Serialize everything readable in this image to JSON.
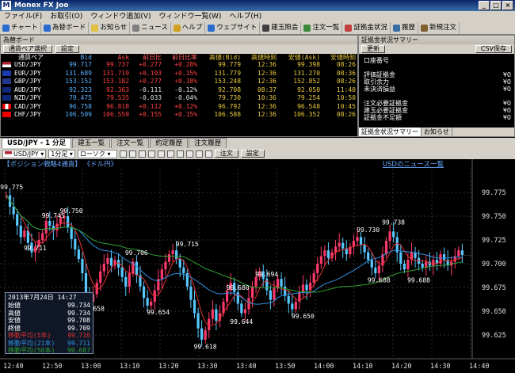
{
  "window": {
    "title": "Monex FX Joo",
    "logo": "M"
  },
  "menu": [
    "ファイル(F)",
    "お取引(O)",
    "ウィンドウ追加(V)",
    "ウィンドウ一覧(W)",
    "ヘルプ(H)"
  ],
  "toolbar": [
    {
      "label": "チャート",
      "color": "#2a6bd0"
    },
    {
      "label": "為替ボード",
      "color": "#2a6bd0"
    },
    {
      "label": "お知らせ",
      "color": "#e0c040"
    },
    {
      "label": "ニュース",
      "color": "#808080"
    },
    {
      "label": "ヘルプ",
      "color": "#d0a020"
    },
    {
      "label": "ウェブサイト",
      "color": "#2a6bd0"
    },
    {
      "label": "建玉照会",
      "color": "#404040"
    },
    {
      "label": "注文一覧",
      "color": "#3a8a3a"
    },
    {
      "label": "証拠金状況",
      "color": "#c04040"
    },
    {
      "label": "履歴",
      "color": "#3a6ea5"
    },
    {
      "label": "新規注文",
      "color": "#806030"
    }
  ],
  "rateboard": {
    "title": "為替ボード",
    "tab": "通貨ペア選択",
    "settings": "設定",
    "columns": [
      "通貨ペア",
      "Bid",
      "Ask",
      "前日比",
      "前日比率",
      "高値(Bid)",
      "高値時刻",
      "安値(Ask)",
      "安値時刻"
    ],
    "rows": [
      {
        "pair": "USD/JPY",
        "bid": "99.717",
        "ask": "99.737",
        "chg": "+0.277",
        "pct": "+0.28%",
        "high": "99.779",
        "htime": "12:36",
        "low": "99.398",
        "ltime": "08:26",
        "up": true
      },
      {
        "pair": "EUR/JPY",
        "bid": "131.689",
        "ask": "131.719",
        "chg": "+0.193",
        "pct": "+0.15%",
        "high": "131.779",
        "htime": "12:36",
        "low": "131.270",
        "ltime": "08:36",
        "up": true
      },
      {
        "pair": "GBP/JPY",
        "bid": "153.152",
        "ask": "153.182",
        "chg": "+0.277",
        "pct": "+0.18%",
        "high": "153.248",
        "htime": "12:36",
        "low": "152.852",
        "ltime": "08:26",
        "up": true
      },
      {
        "pair": "AUD/JPY",
        "bid": "92.323",
        "ask": "92.363",
        "chg": "-0.111",
        "pct": "-0.12%",
        "high": "92.708",
        "htime": "08:37",
        "low": "92.050",
        "ltime": "11:40",
        "up": false
      },
      {
        "pair": "NZD/JPY",
        "bid": "79.475",
        "ask": "79.535",
        "chg": "-0.033",
        "pct": "-0.04%",
        "high": "79.730",
        "htime": "10:36",
        "low": "79.254",
        "ltime": "10:50",
        "up": false
      },
      {
        "pair": "CAD/JPY",
        "bid": "96.758",
        "ask": "96.818",
        "chg": "+0.112",
        "pct": "+0.12%",
        "high": "96.792",
        "htime": "12:36",
        "low": "96.548",
        "ltime": "10:45",
        "up": true
      },
      {
        "pair": "CHF/JPY",
        "bid": "106.509",
        "ask": "106.559",
        "chg": "+0.155",
        "pct": "+0.15%",
        "high": "106.588",
        "htime": "12:36",
        "low": "106.352",
        "ltime": "08:26",
        "up": true
      }
    ]
  },
  "summary": {
    "title": "証拠金状況サマリー",
    "update": "更新",
    "csv": "CSV保存",
    "account": "口座番号",
    "items1": [
      {
        "k": "評価証拠金",
        "v": "¥0"
      },
      {
        "k": "取引余力",
        "v": "¥0"
      },
      {
        "k": "未決済損益",
        "v": "¥0"
      }
    ],
    "items2": [
      {
        "k": "注文必要証拠金",
        "v": "¥0"
      },
      {
        "k": "建玉必要証拠金",
        "v": "¥0"
      },
      {
        "k": "証拠金不足額",
        "v": "¥0"
      }
    ],
    "tabs": [
      "証拠金状況サマリー",
      "お知らせ"
    ]
  },
  "chartwin": {
    "tabs": [
      "USD/JPY - 1 分足",
      "建玉一覧",
      "注文一覧",
      "約定履歴",
      "注文履歴"
    ],
    "pair": "USD/JPY",
    "interval": "1分足",
    "chart_type": "ローソク",
    "order": "注文",
    "settings": "設定",
    "position_label": "【ポジション戦略4通貨】 《ドル円》",
    "news_link": "USDのニュース一覧"
  },
  "infobox": {
    "date": "2013年7月24日 14:27",
    "rows": [
      {
        "k": "始値",
        "v": "99.734",
        "c": "#ffffff"
      },
      {
        "k": "高値",
        "v": "99.734",
        "c": "#ffffff"
      },
      {
        "k": "安値",
        "v": "99.708",
        "c": "#ffffff"
      },
      {
        "k": "終値",
        "v": "99.709",
        "c": "#ffffff"
      },
      {
        "k": "移動平均(5本)",
        "v": "99.716",
        "c": "#e03030"
      },
      {
        "k": "移動平均(21本)",
        "v": "99.711",
        "c": "#3090e0"
      },
      {
        "k": "移動平均(50本)",
        "v": "99.687",
        "c": "#30a030"
      }
    ]
  },
  "chart_data": {
    "type": "candlestick",
    "ylim": [
      99.6,
      99.8
    ],
    "yticks": [
      "99.775",
      "99.750",
      "99.725",
      "99.700",
      "99.675",
      "99.650",
      "99.625"
    ],
    "xticks": [
      "12:40",
      "12:50",
      "13:00",
      "13:10",
      "13:20",
      "13:30",
      "13:40",
      "13:50",
      "14:00",
      "14:10",
      "14:20",
      "14:30",
      "14:40"
    ],
    "annotations": [
      {
        "t": 0.5,
        "v": 99.775,
        "label": "99.775"
      },
      {
        "t": 12,
        "v": 99.745,
        "label": "99.745"
      },
      {
        "t": 17,
        "v": 99.75,
        "label": "99.750"
      },
      {
        "t": 7,
        "v": 99.711,
        "label": "99.711"
      },
      {
        "t": 35,
        "v": 99.706,
        "label": "99.706"
      },
      {
        "t": 23,
        "v": 99.658,
        "label": "99.658"
      },
      {
        "t": 49,
        "v": 99.715,
        "label": "99.715"
      },
      {
        "t": 41,
        "v": 99.654,
        "label": "99.654"
      },
      {
        "t": 54,
        "v": 99.618,
        "label": "99.618"
      },
      {
        "t": 63,
        "v": 99.68,
        "label": "99.680"
      },
      {
        "t": 64,
        "v": 99.644,
        "label": "99.644"
      },
      {
        "t": 71,
        "v": 99.694,
        "label": "99.694"
      },
      {
        "t": 81,
        "v": 99.65,
        "label": "99.650"
      },
      {
        "t": 99,
        "v": 99.73,
        "label": "99.730"
      },
      {
        "t": 106,
        "v": 99.738,
        "label": "99.738"
      },
      {
        "t": 102,
        "v": 99.688,
        "label": "99.688"
      },
      {
        "t": 113,
        "v": 99.688,
        "label": "99.688"
      }
    ],
    "series": [
      {
        "name": "移動平均(5本)",
        "color": "#e03030"
      },
      {
        "name": "移動平均(21本)",
        "color": "#3090e0"
      },
      {
        "name": "移動平均(50本)",
        "color": "#30a030"
      }
    ],
    "closes": [
      99.772,
      99.76,
      99.752,
      99.74,
      99.728,
      99.735,
      99.722,
      99.712,
      99.718,
      99.725,
      99.732,
      99.745,
      99.74,
      99.735,
      99.742,
      99.748,
      99.75,
      99.738,
      99.726,
      99.715,
      99.705,
      99.69,
      99.67,
      99.66,
      99.668,
      99.68,
      99.692,
      99.7,
      99.706,
      99.698,
      99.704,
      99.696,
      99.686,
      99.676,
      99.69,
      99.702,
      99.688,
      99.676,
      99.664,
      99.656,
      99.66,
      99.672,
      99.684,
      99.694,
      99.702,
      99.71,
      99.714,
      99.705,
      99.696,
      99.69,
      99.676,
      99.662,
      99.648,
      99.632,
      99.62,
      99.63,
      99.642,
      99.652,
      99.64,
      99.648,
      99.66,
      99.672,
      99.68,
      99.67,
      99.658,
      99.648,
      99.652,
      99.664,
      99.676,
      99.686,
      99.692,
      99.684,
      99.672,
      99.662,
      99.674,
      99.684,
      99.676,
      99.666,
      99.658,
      99.652,
      99.66,
      99.67,
      99.678,
      99.672,
      99.68,
      99.69,
      99.7,
      99.708,
      99.714,
      99.706,
      99.712,
      99.718,
      99.722,
      99.716,
      99.71,
      99.718,
      99.724,
      99.728,
      99.72,
      99.712,
      99.704,
      99.696,
      99.69,
      99.698,
      99.71,
      99.724,
      99.734,
      99.728,
      99.712,
      99.7,
      99.694,
      99.704,
      99.712,
      99.706,
      99.7,
      99.696,
      99.702,
      99.698,
      99.704,
      99.7,
      99.71,
      99.704,
      99.698,
      99.702,
      99.708,
      99.714,
      99.709
    ]
  }
}
